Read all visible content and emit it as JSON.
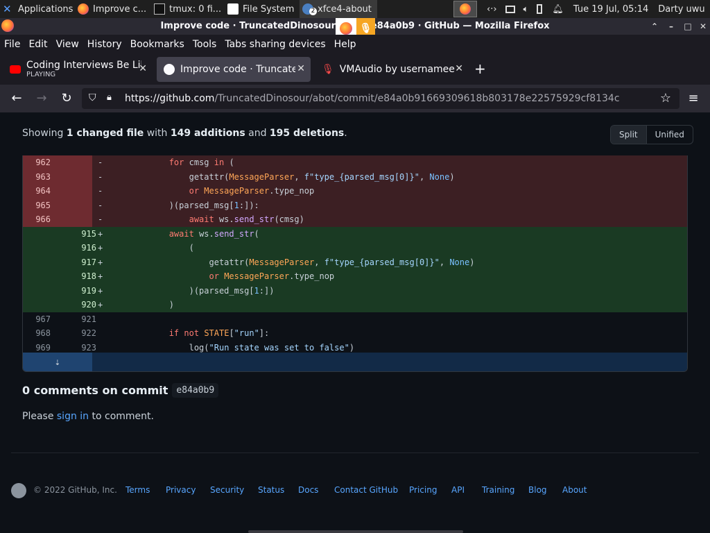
{
  "panel": {
    "applications": "Applications",
    "tasks": [
      "Improve c...",
      "tmux: 0 fi...",
      "File System",
      "xfce4-about"
    ],
    "xfce_badge": "2",
    "clock": "Tue 19 Jul, 05:14",
    "user": "Darty uwu"
  },
  "window": {
    "title": "Improve code · TruncatedDinosour/abot@e84a0b9 · GitHub — Mozilla Firefox"
  },
  "menu": [
    "File",
    "Edit",
    "View",
    "History",
    "Bookmarks",
    "Tools",
    "Tabs sharing devices",
    "Help"
  ],
  "tabs": [
    {
      "label": "Coding Interviews Be Like",
      "sub": "PLAYING"
    },
    {
      "label": "Improve code · TruncatedDinosour"
    },
    {
      "label": "VMAudio by usernamee"
    }
  ],
  "nav": {
    "url_host": "https://github.com",
    "url_path": "/TruncatedDinosour/abot/commit/e84a0b91669309618b803178e22575929cf8134c"
  },
  "summary": {
    "prefix": "Showing ",
    "files": "1 changed file",
    "mid1": " with ",
    "additions": "149 additions",
    "mid2": " and ",
    "deletions": "195 deletions",
    "suffix": "."
  },
  "view_toggle": {
    "split": "Split",
    "unified": "Unified"
  },
  "diff": {
    "rows": [
      {
        "type": "del",
        "old": "962",
        "new": "",
        "marker": "-"
      },
      {
        "type": "del",
        "old": "963",
        "new": "",
        "marker": "-"
      },
      {
        "type": "del",
        "old": "964",
        "new": "",
        "marker": "-"
      },
      {
        "type": "del",
        "old": "965",
        "new": "",
        "marker": "-"
      },
      {
        "type": "del",
        "old": "966",
        "new": "",
        "marker": "-"
      },
      {
        "type": "add",
        "old": "",
        "new": "915",
        "marker": "+"
      },
      {
        "type": "add",
        "old": "",
        "new": "916",
        "marker": "+"
      },
      {
        "type": "add",
        "old": "",
        "new": "917",
        "marker": "+"
      },
      {
        "type": "add",
        "old": "",
        "new": "918",
        "marker": "+"
      },
      {
        "type": "add",
        "old": "",
        "new": "919",
        "marker": "+"
      },
      {
        "type": "add",
        "old": "",
        "new": "920",
        "marker": "+"
      },
      {
        "type": "ctx",
        "old": "967",
        "new": "921",
        "marker": ""
      },
      {
        "type": "ctx",
        "old": "968",
        "new": "922",
        "marker": ""
      },
      {
        "type": "ctx",
        "old": "969",
        "new": "923",
        "marker": ""
      }
    ],
    "code": [
      "            for cmsg in (",
      "                getattr(MessageParser, f\"type_{parsed_msg[0]}\", None)",
      "                or MessageParser.type_nop",
      "            )(parsed_msg[1:]):",
      "                await ws.send_str(cmsg)",
      "            await ws.send_str(",
      "                (",
      "                    getattr(MessageParser, f\"type_{parsed_msg[0]}\", None)",
      "                    or MessageParser.type_nop",
      "                )(parsed_msg[1:])",
      "            )",
      "",
      "            if not STATE[\"run\"]:",
      "                log(\"Run state was set to false\")"
    ]
  },
  "comments": {
    "title": "0 comments on commit",
    "sha": "e84a0b9",
    "please": "Please ",
    "sign_in": "sign in",
    "to_comment": " to comment."
  },
  "footer": {
    "copyright": "© 2022 GitHub, Inc.",
    "links": [
      "Terms",
      "Privacy",
      "Security",
      "Status",
      "Docs",
      "Contact GitHub",
      "Pricing",
      "API",
      "Training",
      "Blog",
      "About"
    ]
  },
  "colors": {
    "background": "#0d1117",
    "deletion_row": "#3c1f23",
    "addition_row": "#1a3a23",
    "link": "#58a6ff"
  }
}
